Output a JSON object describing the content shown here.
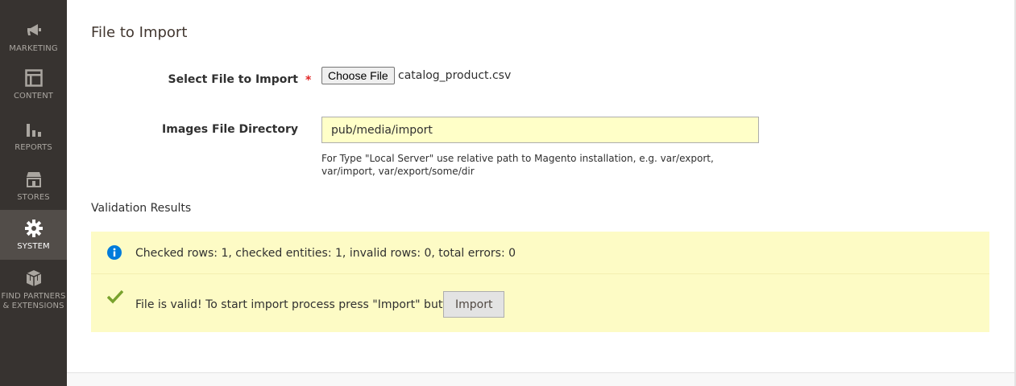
{
  "sidebar": {
    "items": [
      {
        "label": "MARKETING",
        "icon": "megaphone-icon"
      },
      {
        "label": "CONTENT",
        "icon": "layout-icon"
      },
      {
        "label": "REPORTS",
        "icon": "bar-chart-icon"
      },
      {
        "label": "STORES",
        "icon": "storefront-icon"
      },
      {
        "label": "SYSTEM",
        "icon": "gear-icon",
        "active": true
      },
      {
        "label_line1": "FIND PARTNERS",
        "label_line2": "& EXTENSIONS",
        "icon": "cubes-icon"
      }
    ]
  },
  "section": {
    "title": "File to Import"
  },
  "form": {
    "select_file_label": "Select File to Import",
    "required_mark": "*",
    "choose_file_label": "Choose File",
    "selected_file": "catalog_product.csv",
    "images_dir_label": "Images File Directory",
    "images_dir_value": "pub/media/import",
    "images_dir_hint": "For Type \"Local Server\" use relative path to Magento installation, e.g. var/export, var/import, var/export/some/dir"
  },
  "validation": {
    "title": "Validation Results",
    "info_message": "Checked rows: 1, checked entities: 1, invalid rows: 0, total errors: 0",
    "success_message": "File is valid! To start import process press \"Import\" button",
    "import_button": "Import"
  },
  "colors": {
    "sidebar_bg": "#373330",
    "sidebar_active": "#524d49",
    "message_bg": "#fdfbc5",
    "info_icon": "#007bdb",
    "success_icon": "#79a22e",
    "required": "#e22626"
  }
}
